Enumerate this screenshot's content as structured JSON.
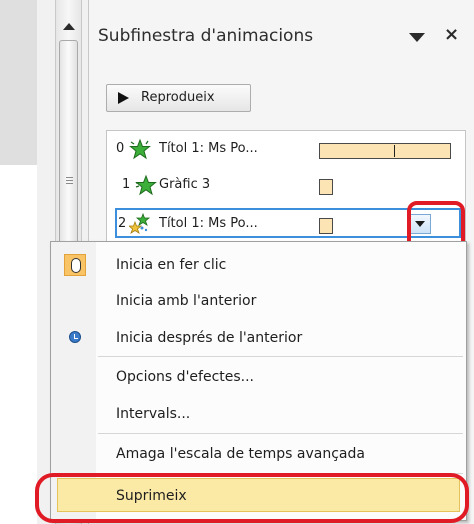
{
  "pane": {
    "title": "Subfinestra d'animacions",
    "close_glyph": "×",
    "play_label": "Reprodueix"
  },
  "animations": [
    {
      "number": "0",
      "name": "Títol 1: Ms Po...",
      "icon": "green-star-icon"
    },
    {
      "number": "1",
      "name": "Gràfic 3",
      "icon": "green-star-icon"
    },
    {
      "number": "2",
      "name": "Títol 1: Ms Po...",
      "icon": "multicolor-star-icon"
    }
  ],
  "context_menu": {
    "items": [
      {
        "label": "Inicia en fer clic",
        "icon": "mouse-icon",
        "highlighted": false
      },
      {
        "label": "Inicia amb l'anterior",
        "icon": "",
        "highlighted": false
      },
      {
        "label": "Inicia després de l'anterior",
        "icon": "clock-icon",
        "highlighted": false
      },
      {
        "label": "Opcions d'efectes...",
        "icon": "",
        "highlighted": false
      },
      {
        "label": "Intervals...",
        "icon": "",
        "highlighted": false
      },
      {
        "label": "Amaga l'escala de temps avançada",
        "icon": "",
        "highlighted": false
      },
      {
        "label": "Suprimeix",
        "icon": "",
        "highlighted": true
      }
    ]
  },
  "colors": {
    "highlight_red": "#e01b25",
    "timing_bar": "#fde4b4",
    "hover_bg": "#fbe9a6",
    "selection_blue": "#3c8fdd"
  }
}
